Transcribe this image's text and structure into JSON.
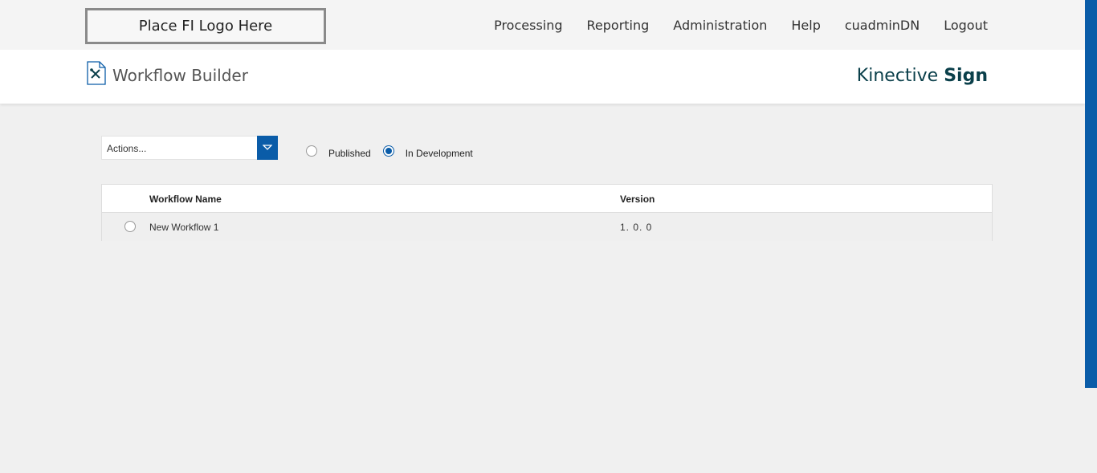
{
  "topbar": {
    "logo_text": "Place FI Logo Here",
    "nav": [
      "Processing",
      "Reporting",
      "Administration",
      "Help",
      "cuadminDN",
      "Logout"
    ]
  },
  "header": {
    "title": "Workflow Builder",
    "icon": "workflow-tools-icon",
    "brand_light": "Kinective",
    "brand_bold": "Sign"
  },
  "toolbar": {
    "actions_label": "Actions...",
    "filters": [
      {
        "label": "Published",
        "selected": false
      },
      {
        "label": "In Development",
        "selected": true
      }
    ]
  },
  "table": {
    "columns": [
      "Workflow Name",
      "Version"
    ],
    "rows": [
      {
        "name": "New Workflow 1",
        "version": "1. 0. 0"
      }
    ]
  },
  "colors": {
    "accent": "#0a5ca8",
    "brand": "#0a3f4a"
  }
}
